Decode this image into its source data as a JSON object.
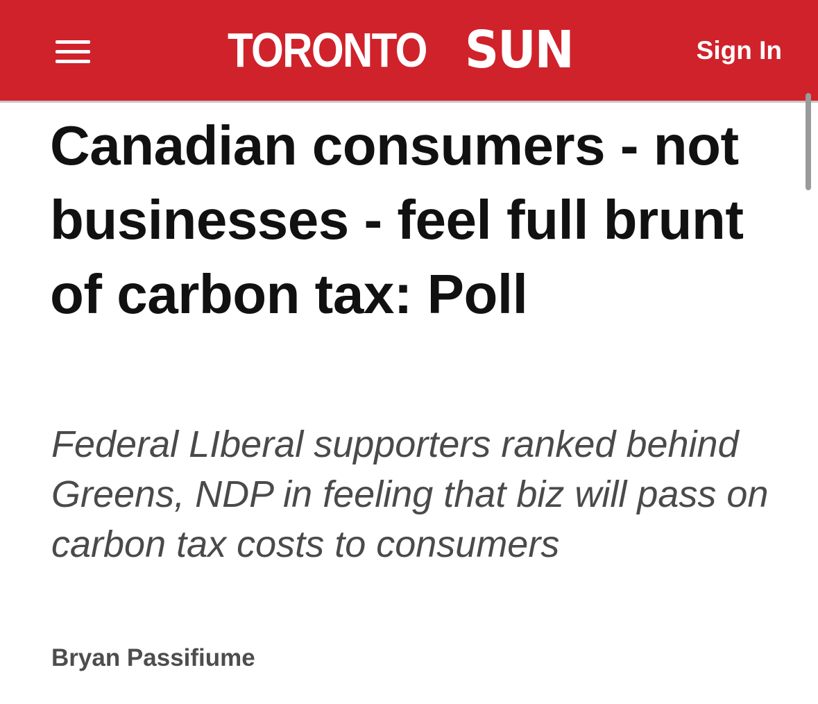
{
  "header": {
    "logo_part1": "TORONTO",
    "logo_part2": "SUN",
    "sign_in_label": "Sign In",
    "menu_icon": "hamburger-menu-icon",
    "brand_color": "#d0222b"
  },
  "article": {
    "headline": "Canadian consumers - not businesses - feel full brunt of carbon tax: Poll",
    "subheadline": "Federal LIberal supporters ranked behind Greens, NDP in feeling that biz will pass on carbon tax costs to consumers",
    "author": "Bryan Passifiume"
  }
}
